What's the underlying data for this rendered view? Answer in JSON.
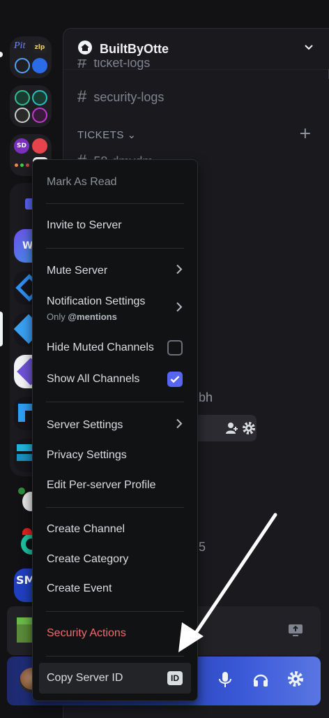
{
  "server": {
    "name": "BuiltByOtte"
  },
  "channels": [
    {
      "name": "ticket-logs"
    },
    {
      "name": "security-logs"
    },
    {
      "name": "58-dmvdm"
    }
  ],
  "category": {
    "label": "TICKETS ⌄"
  },
  "partial_texts": {
    "bh": "bh",
    "five": "5"
  },
  "context_menu": {
    "mark_as_read": "Mark As Read",
    "invite": "Invite to Server",
    "mute_server": "Mute Server",
    "notification_settings": "Notification Settings",
    "notification_sub_prefix": "Only",
    "notification_sub_value": "@mentions",
    "hide_muted_channels": "Hide Muted Channels",
    "hide_muted_checked": false,
    "show_all_channels": "Show All Channels",
    "show_all_checked": true,
    "server_settings": "Server Settings",
    "privacy_settings": "Privacy Settings",
    "edit_profile": "Edit Per-server Profile",
    "create_channel": "Create Channel",
    "create_category": "Create Category",
    "create_event": "Create Event",
    "security_actions": "Security Actions",
    "copy_server_id": "Copy Server ID",
    "id_badge": "ID"
  },
  "server_rail": {
    "folder_labels": [
      "Pit",
      "zlp"
    ],
    "sd_label": "SD",
    "sm_label": "SM",
    "w_label": "W"
  },
  "colors": {
    "accent": "#5865f2",
    "danger": "#f26b6e",
    "menu_bg": "#111214",
    "sidebar_bg": "#1a1a1e"
  },
  "icons": [
    "home-icon",
    "chevron-down-icon",
    "hash-icon",
    "plus-icon",
    "chevron-right-icon",
    "checkmark-icon",
    "id-icon",
    "add-member-icon",
    "gear-icon",
    "microphone-icon",
    "headphones-icon",
    "screen-share-icon",
    "arrow-annotation"
  ]
}
